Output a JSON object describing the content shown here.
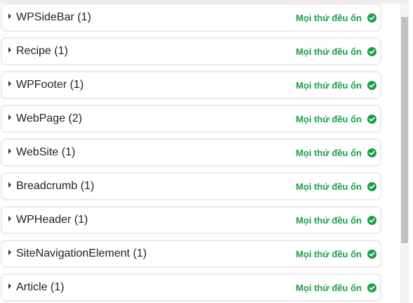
{
  "status_label": "Mọi thứ đều ổn",
  "status_color": "#1a9f45",
  "items": [
    {
      "label": "WPSideBar (1)"
    },
    {
      "label": "Recipe (1)"
    },
    {
      "label": "WPFooter (1)"
    },
    {
      "label": "WebPage (2)"
    },
    {
      "label": "WebSite (1)"
    },
    {
      "label": "Breadcrumb (1)"
    },
    {
      "label": "WPHeader (1)"
    },
    {
      "label": "SiteNavigationElement (1)"
    },
    {
      "label": "Article (1)"
    }
  ]
}
